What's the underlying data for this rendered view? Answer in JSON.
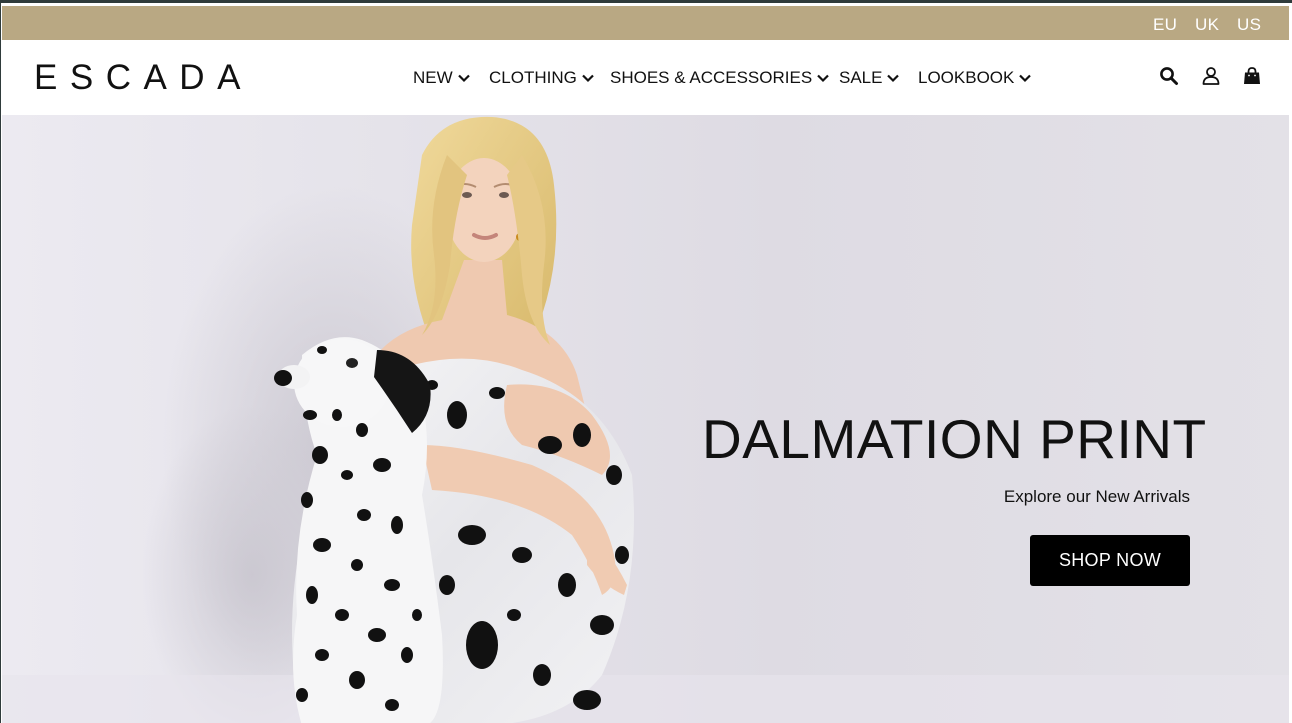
{
  "regions": [
    "EU",
    "UK",
    "US"
  ],
  "brand": {
    "logo_text": "ESCADA"
  },
  "nav": {
    "items": [
      {
        "label": "NEW"
      },
      {
        "label": "CLOTHING"
      },
      {
        "label": "SHOES & ACCESSORIES"
      },
      {
        "label": "SALE"
      },
      {
        "label": "LOOKBOOK"
      }
    ]
  },
  "header_icons": [
    "search-icon",
    "account-icon",
    "shopping-bag-icon"
  ],
  "hero": {
    "title": "DALMATION PRINT",
    "subtitle": "Explore our New Arrivals",
    "cta_label": "SHOP NOW"
  },
  "colors": {
    "topbar": "#b9a883",
    "cta_background": "#000000",
    "cta_text": "#ffffff",
    "text": "#111111"
  }
}
